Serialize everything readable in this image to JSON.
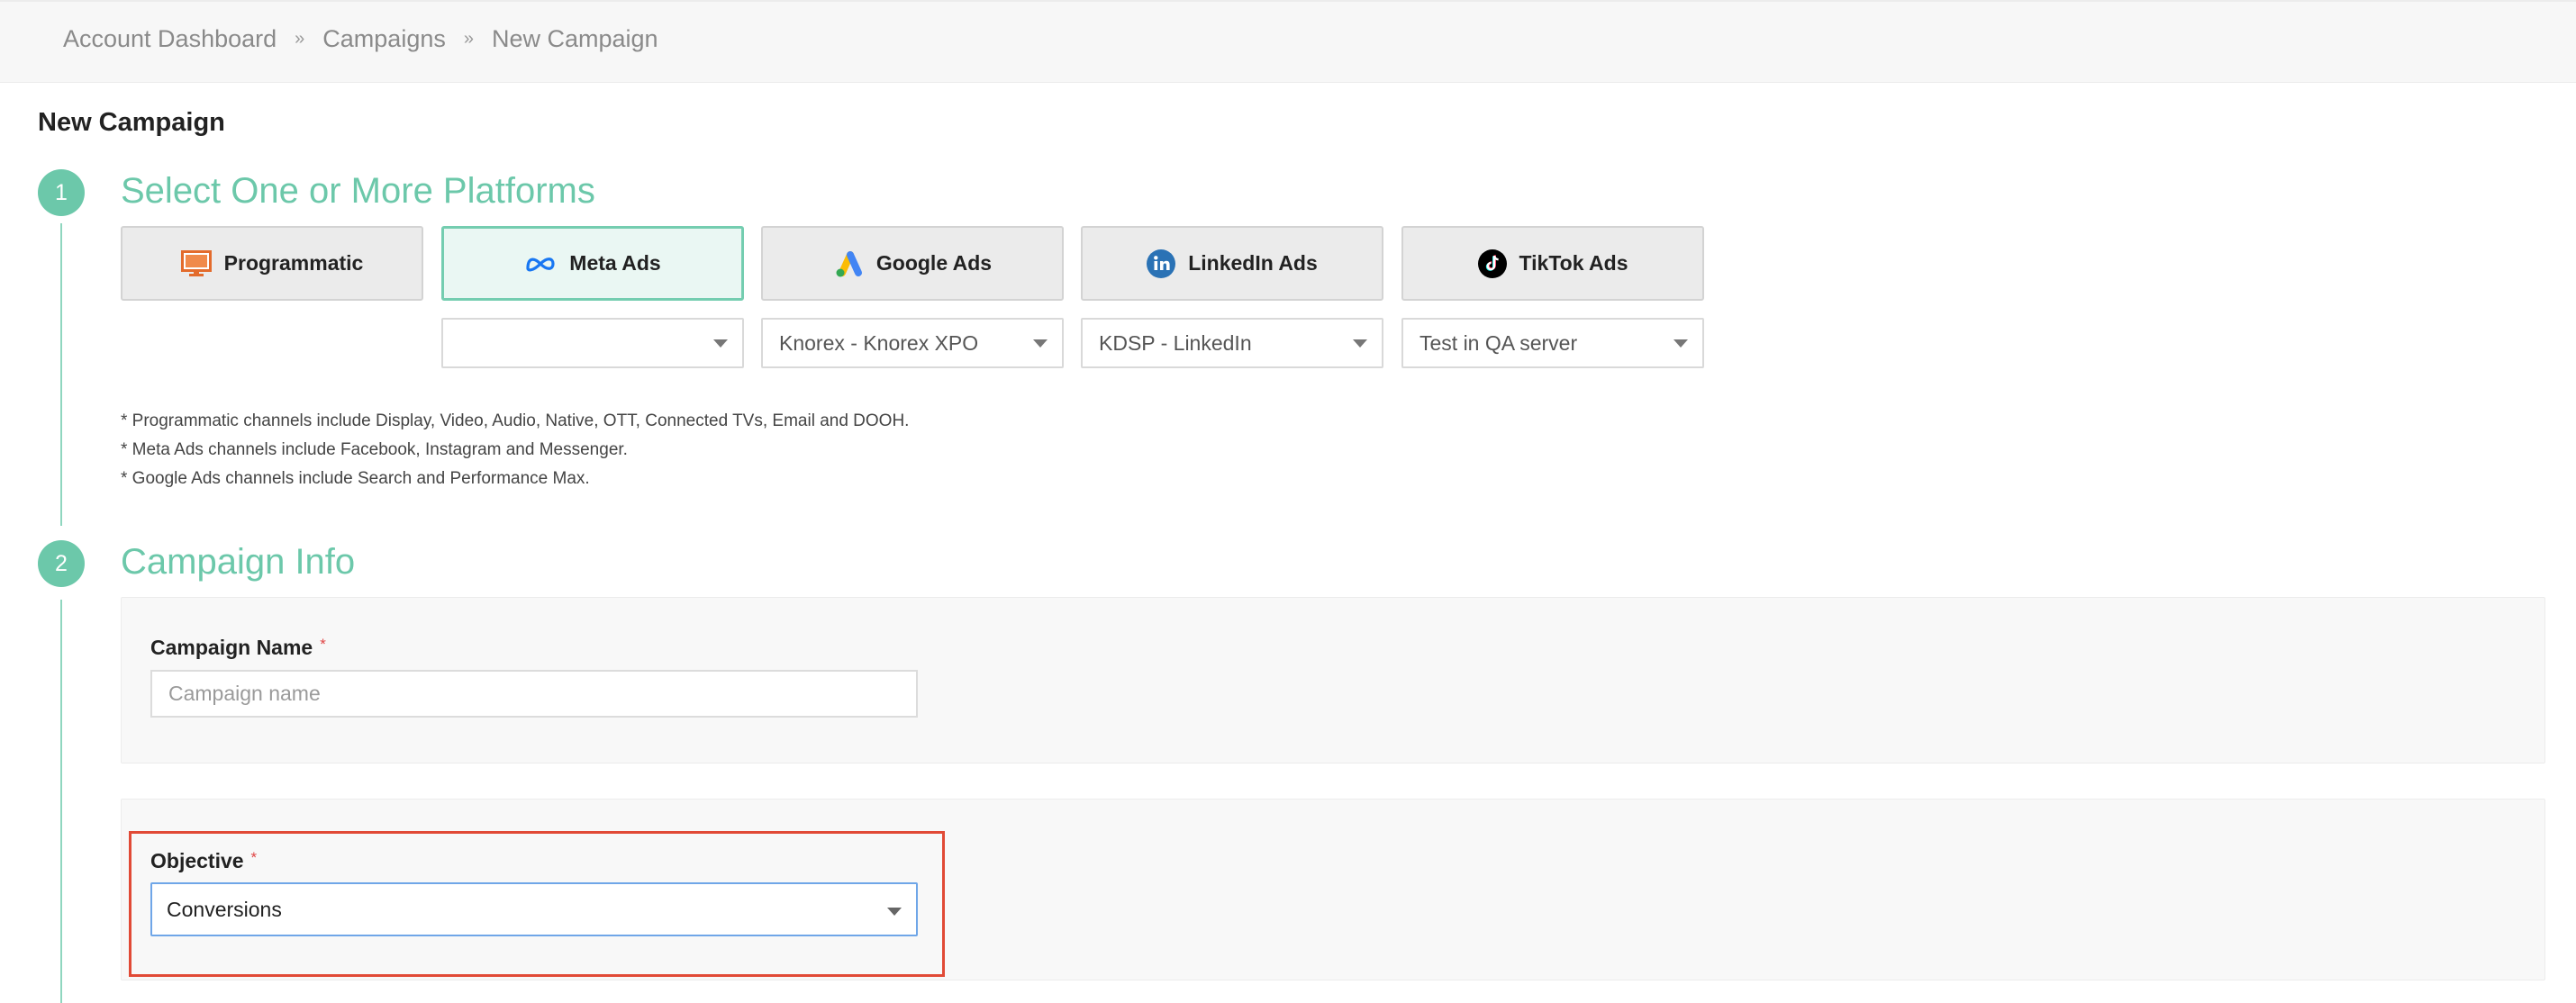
{
  "breadcrumb": {
    "items": [
      "Account Dashboard",
      "Campaigns",
      "New Campaign"
    ],
    "separator": "»"
  },
  "page": {
    "title": "New Campaign"
  },
  "colors": {
    "accent": "#6cc8aa",
    "highlight": "#e14a36",
    "focus_border": "#6fa6e8"
  },
  "step1": {
    "number": "1",
    "title": "Select One or More Platforms",
    "platforms": [
      {
        "label": "Programmatic",
        "icon": "monitor-icon",
        "selected": false
      },
      {
        "label": "Meta Ads",
        "icon": "meta-logo-icon",
        "selected": true
      },
      {
        "label": "Google Ads",
        "icon": "google-ads-logo-icon",
        "selected": false
      },
      {
        "label": "LinkedIn Ads",
        "icon": "linkedin-logo-icon",
        "selected": false
      },
      {
        "label": "TikTok Ads",
        "icon": "tiktok-logo-icon",
        "selected": false
      }
    ],
    "accounts": [
      {
        "value": ""
      },
      {
        "value": "Knorex - Knorex XPO"
      },
      {
        "value": "KDSP - LinkedIn"
      },
      {
        "value": "Test in QA server"
      }
    ],
    "notes": [
      "* Programmatic channels include Display, Video, Audio, Native, OTT, Connected TVs, Email and DOOH.",
      "* Meta Ads channels include Facebook, Instagram and Messenger.",
      "* Google Ads channels include Search and Performance Max."
    ]
  },
  "step2": {
    "number": "2",
    "title": "Campaign Info",
    "campaign_name": {
      "label": "Campaign Name",
      "required_mark": "*",
      "placeholder": "Campaign name",
      "value": ""
    },
    "objective": {
      "label": "Objective",
      "required_mark": "*",
      "value": "Conversions"
    }
  }
}
